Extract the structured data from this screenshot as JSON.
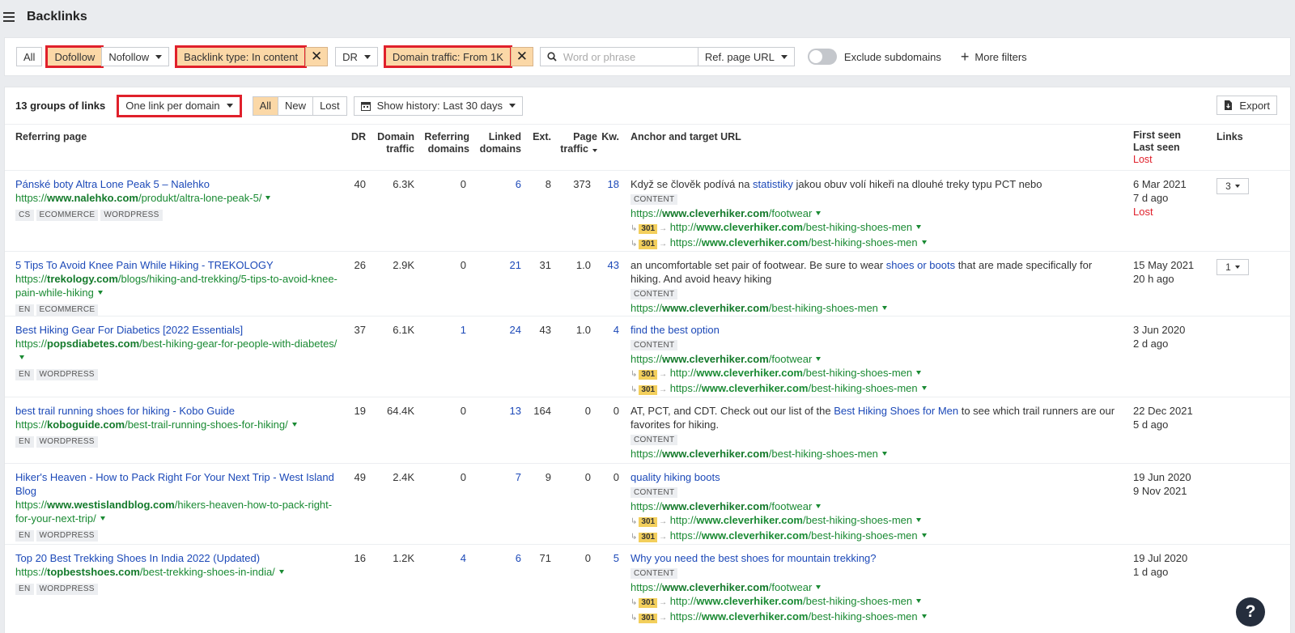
{
  "header": {
    "title": "Backlinks"
  },
  "filters": {
    "all": "All",
    "dofollow": "Dofollow",
    "nofollow": "Nofollow",
    "backlink_type": "Backlink type: In content",
    "dr": "DR",
    "domain_traffic": "Domain traffic: From 1K",
    "search_placeholder": "Word or phrase",
    "ref_page_url": "Ref. page URL",
    "exclude_subdomains": "Exclude subdomains",
    "more_filters": "More filters"
  },
  "toolbar": {
    "groups_count": "13 groups of links",
    "grouping": "One link per domain",
    "tabs": [
      "All",
      "New",
      "Lost"
    ],
    "history": "Show history: Last 30 days",
    "export": "Export"
  },
  "columns": {
    "referring_page": "Referring page",
    "dr": "DR",
    "domain_traffic": [
      "Domain",
      "traffic"
    ],
    "referring_domains": [
      "Referring",
      "domains"
    ],
    "linked_domains": [
      "Linked",
      "domains"
    ],
    "ext": "Ext.",
    "page_traffic": [
      "Page",
      "traffic"
    ],
    "kw": "Kw.",
    "anchor": "Anchor and target URL",
    "first_seen": "First seen",
    "last_seen": "Last seen",
    "lost": "Lost",
    "links": "Links"
  },
  "rows": [
    {
      "title": "Pánské boty Altra Lone Peak 5 – Nalehko",
      "url_pre": "https://",
      "url_domain": "www.nalehko.com",
      "url_path": "/produkt/altra-lone-peak-5/",
      "tags": [
        "CS",
        "ECOMMERCE",
        "WORDPRESS"
      ],
      "dr": "40",
      "domain_traffic": "6.3K",
      "ref_domains": "0",
      "linked_domains": "6",
      "ext": "8",
      "page_traffic": "373",
      "kw": "18",
      "anchor_before": "Když se člověk podívá na ",
      "anchor_link": "statistiky",
      "anchor_after": " jakou obuv volí hikeři na dlouhé treky typu PCT nebo",
      "content_tag": "CONTENT",
      "target_pre": "https://",
      "target_domain": "www.cleverhiker.com",
      "target_path": "/footwear",
      "redirects": [
        {
          "code": "301",
          "pre": "http://",
          "domain": "www.cleverhiker.com",
          "path": "/best-hiking-shoes-men"
        },
        {
          "code": "301",
          "pre": "https://",
          "domain": "www.cleverhiker.com",
          "path": "/best-hiking-shoes-men"
        }
      ],
      "first_seen": "6 Mar 2021",
      "last_seen": "7 d ago",
      "lost": "Lost",
      "links": "3"
    },
    {
      "title": "5 Tips To Avoid Knee Pain While Hiking - TREKOLOGY",
      "url_pre": "https://",
      "url_domain": "trekology.com",
      "url_path": "/blogs/hiking-and-trekking/5-tips-to-avoid-knee-pain-while-hiking",
      "tags": [
        "EN",
        "ECOMMERCE"
      ],
      "dr": "26",
      "domain_traffic": "2.9K",
      "ref_domains": "0",
      "linked_domains": "21",
      "ext": "31",
      "page_traffic": "1.0",
      "kw": "43",
      "anchor_before": "an uncomfortable set pair of footwear. Be sure to wear ",
      "anchor_link": "shoes or boots",
      "anchor_after": " that are made specifically for hiking. And avoid heavy hiking",
      "content_tag": "CONTENT",
      "target_pre": "https://",
      "target_domain": "www.cleverhiker.com",
      "target_path": "/best-hiking-shoes-men",
      "first_seen": "15 May 2021",
      "last_seen": "20 h ago",
      "links": "1"
    },
    {
      "title": "Best Hiking Gear For Diabetics [2022 Essentials]",
      "url_pre": "https://",
      "url_domain": "popsdiabetes.com",
      "url_path": "/best-hiking-gear-for-people-with-diabetes/",
      "tags": [
        "EN",
        "WORDPRESS"
      ],
      "dr": "37",
      "domain_traffic": "6.1K",
      "ref_domains": "1",
      "linked_domains": "24",
      "ext": "43",
      "page_traffic": "1.0",
      "kw": "4",
      "anchor_link": "find the best option",
      "content_tag": "CONTENT",
      "target_pre": "https://",
      "target_domain": "www.cleverhiker.com",
      "target_path": "/footwear",
      "redirects": [
        {
          "code": "301",
          "pre": "http://",
          "domain": "www.cleverhiker.com",
          "path": "/best-hiking-shoes-men"
        },
        {
          "code": "301",
          "pre": "https://",
          "domain": "www.cleverhiker.com",
          "path": "/best-hiking-shoes-men"
        }
      ],
      "first_seen": "3 Jun 2020",
      "last_seen": "2 d ago"
    },
    {
      "title": "best trail running shoes for hiking - Kobo Guide",
      "url_pre": "https://",
      "url_domain": "koboguide.com",
      "url_path": "/best-trail-running-shoes-for-hiking/",
      "tags": [
        "EN",
        "WORDPRESS"
      ],
      "dr": "19",
      "domain_traffic": "64.4K",
      "ref_domains": "0",
      "linked_domains": "13",
      "ext": "164",
      "page_traffic": "0",
      "kw": "0",
      "anchor_before": "AT, PCT, and CDT. Check out our list of the ",
      "anchor_link": "Best Hiking Shoes for Men",
      "anchor_after": " to see which trail runners are our favorites for hiking.",
      "content_tag": "CONTENT",
      "target_pre": "https://",
      "target_domain": "www.cleverhiker.com",
      "target_path": "/best-hiking-shoes-men",
      "first_seen": "22 Dec 2021",
      "last_seen": "5 d ago"
    },
    {
      "title": "Hiker's Heaven - How to Pack Right For Your Next Trip - West Island Blog",
      "url_pre": "https://",
      "url_domain": "www.westislandblog.com",
      "url_path": "/hikers-heaven-how-to-pack-right-for-your-next-trip/",
      "tags": [
        "EN",
        "WORDPRESS"
      ],
      "dr": "49",
      "domain_traffic": "2.4K",
      "ref_domains": "0",
      "linked_domains": "7",
      "ext": "9",
      "page_traffic": "0",
      "kw": "0",
      "anchor_link": "quality hiking boots",
      "content_tag": "CONTENT",
      "target_pre": "https://",
      "target_domain": "www.cleverhiker.com",
      "target_path": "/footwear",
      "redirects": [
        {
          "code": "301",
          "pre": "http://",
          "domain": "www.cleverhiker.com",
          "path": "/best-hiking-shoes-men"
        },
        {
          "code": "301",
          "pre": "https://",
          "domain": "www.cleverhiker.com",
          "path": "/best-hiking-shoes-men"
        }
      ],
      "first_seen": "19 Jun 2020",
      "last_seen": "9 Nov 2021"
    },
    {
      "title": "Top 20 Best Trekking Shoes In India 2022 (Updated)",
      "url_pre": "https://",
      "url_domain": "topbestshoes.com",
      "url_path": "/best-trekking-shoes-in-india/",
      "tags": [
        "EN",
        "WORDPRESS"
      ],
      "dr": "16",
      "domain_traffic": "1.2K",
      "ref_domains": "4",
      "linked_domains": "6",
      "ext": "71",
      "page_traffic": "0",
      "kw": "5",
      "anchor_link": "Why you need the best shoes for mountain trekking?",
      "content_tag": "CONTENT",
      "target_pre": "https://",
      "target_domain": "www.cleverhiker.com",
      "target_path": "/footwear",
      "redirects": [
        {
          "code": "301",
          "pre": "http://",
          "domain": "www.cleverhiker.com",
          "path": "/best-hiking-shoes-men"
        },
        {
          "code": "301",
          "pre": "https://",
          "domain": "www.cleverhiker.com",
          "path": "/best-hiking-shoes-men"
        }
      ],
      "first_seen": "19 Jul 2020",
      "last_seen": "1 d ago"
    }
  ],
  "help": {
    "label": "?"
  },
  "colors": {
    "accent_bg": "#fbd8a7",
    "highlight_outline": "#e0202b",
    "link": "#1c49b8",
    "url": "#1a8a33",
    "redirect_badge": "#f3cf5c"
  }
}
